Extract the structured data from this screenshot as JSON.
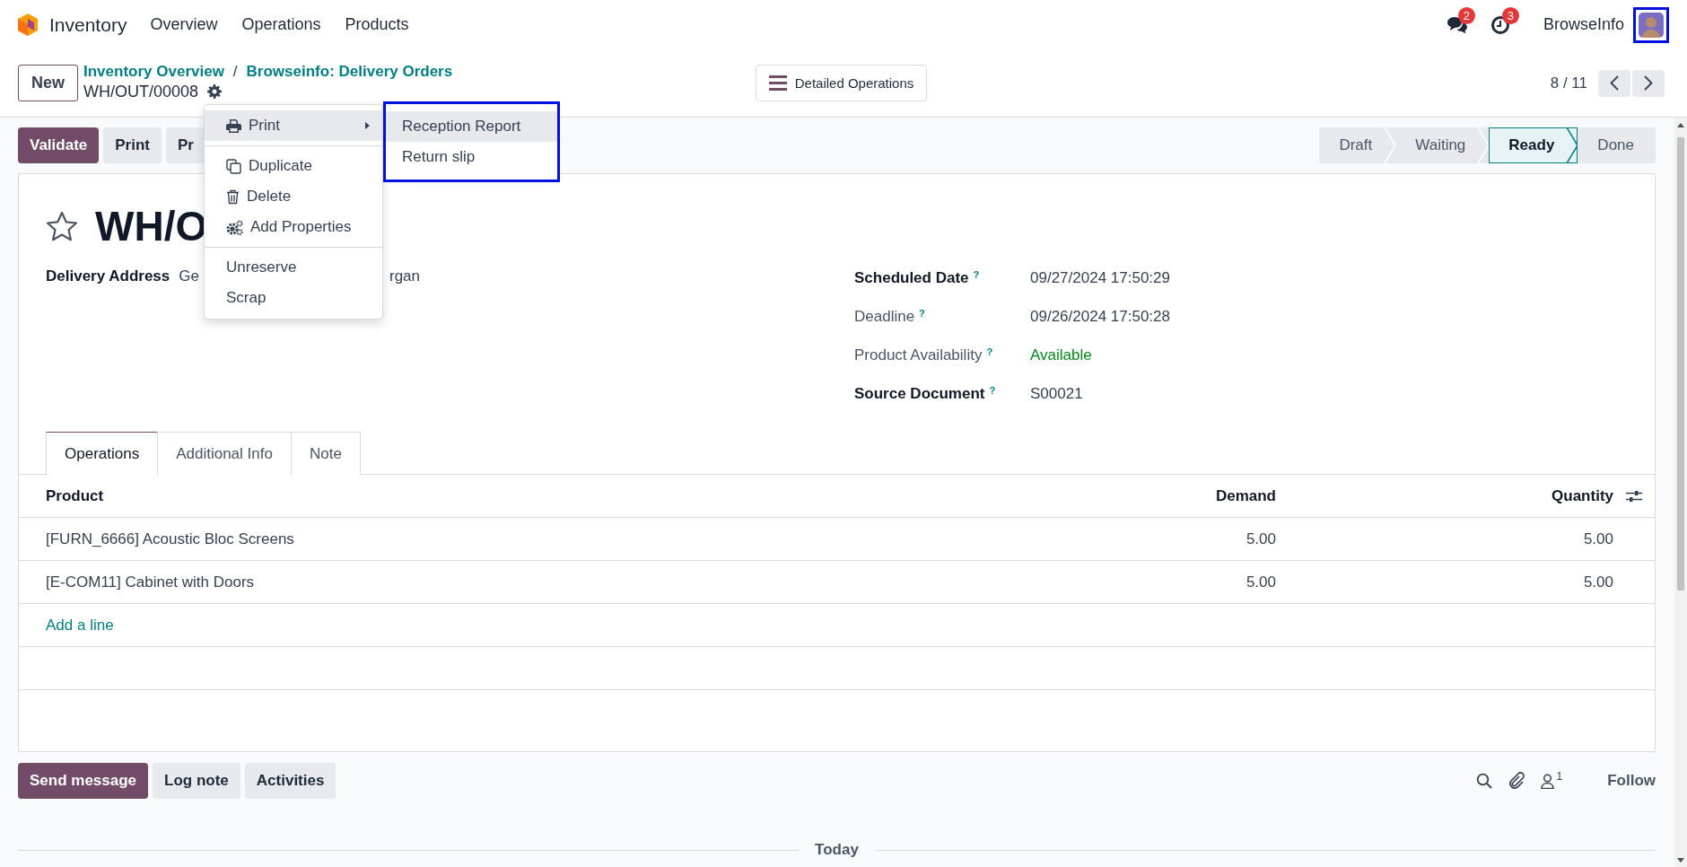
{
  "navbar": {
    "app_name": "Inventory",
    "menus": [
      "Overview",
      "Operations",
      "Products"
    ],
    "messages_badge": "2",
    "activities_badge": "3",
    "user": "BrowseInfo",
    "avatar_highlighted": true
  },
  "control_panel": {
    "new_button": "New",
    "breadcrumbs": [
      "Inventory Overview",
      "Browseinfo: Delivery Orders"
    ],
    "breadcrumb_separator": "/",
    "record_name": "WH/OUT/00008",
    "center_button": "Detailed Operations",
    "pager": "8 / 11"
  },
  "action_buttons": [
    {
      "label": "Validate",
      "kind": "primary"
    },
    {
      "label": "Print",
      "kind": "secondary"
    },
    {
      "label": "Pr",
      "kind": "secondary"
    }
  ],
  "stages": [
    {
      "label": "Draft",
      "selected": false
    },
    {
      "label": "Waiting",
      "selected": false
    },
    {
      "label": "Ready",
      "selected": true
    },
    {
      "label": "Done",
      "selected": false
    }
  ],
  "action_menu": {
    "groups": [
      [
        {
          "label": "Print",
          "selected": true,
          "has_submenu": true
        }
      ],
      [
        {
          "label": "Duplicate",
          "selected": false,
          "has_submenu": false
        },
        {
          "label": "Delete",
          "selected": false,
          "has_submenu": false
        },
        {
          "label": "Add Properties",
          "selected": false,
          "has_submenu": false
        }
      ],
      [
        {
          "label": "Unreserve",
          "selected": false,
          "has_submenu": false
        },
        {
          "label": "Scrap",
          "selected": false,
          "has_submenu": false
        }
      ]
    ],
    "submenu": {
      "highlighted": true,
      "items": [
        {
          "label": "Reception Report",
          "selected": true
        },
        {
          "label": "Return slip",
          "selected": false
        }
      ]
    }
  },
  "sheet": {
    "starred": false,
    "title": "WH/O",
    "delivery_address": {
      "label": "Delivery Address",
      "value_parts": [
        "Ge",
        "rgan"
      ]
    },
    "fields": [
      {
        "label": "Scheduled Date",
        "help": "?",
        "value": "09/27/2024 17:50:29",
        "required": true,
        "color": "#374151"
      },
      {
        "label": "Deadline",
        "help": "?",
        "value": "09/26/2024 17:50:28",
        "required": false,
        "color": "#374151"
      },
      {
        "label": "Product Availability",
        "help": "?",
        "value": "Available",
        "required": false,
        "color": "#008818"
      },
      {
        "label": "Source Document",
        "help": "?",
        "value": "S00021",
        "required": true,
        "color": "#374151"
      }
    ],
    "tabs": [
      {
        "label": "Operations",
        "selected": true
      },
      {
        "label": "Additional Info",
        "selected": false
      },
      {
        "label": "Note",
        "selected": false
      }
    ],
    "table": {
      "columns": [
        "Product",
        "Demand",
        "Quantity"
      ],
      "rows": [
        [
          "[FURN_6666] Acoustic Bloc Screens",
          "5.00",
          "5.00"
        ],
        [
          "[E-COM11] Cabinet with Doors",
          "5.00",
          "5.00"
        ]
      ],
      "add_line": "Add a line"
    }
  },
  "chatter": {
    "buttons": [
      {
        "label": "Send message",
        "kind": "primary"
      },
      {
        "label": "Log note",
        "kind": "secondary"
      },
      {
        "label": "Activities",
        "kind": "secondary"
      }
    ],
    "followers_count": "1",
    "follow": "Follow",
    "divider_label": "Today"
  }
}
